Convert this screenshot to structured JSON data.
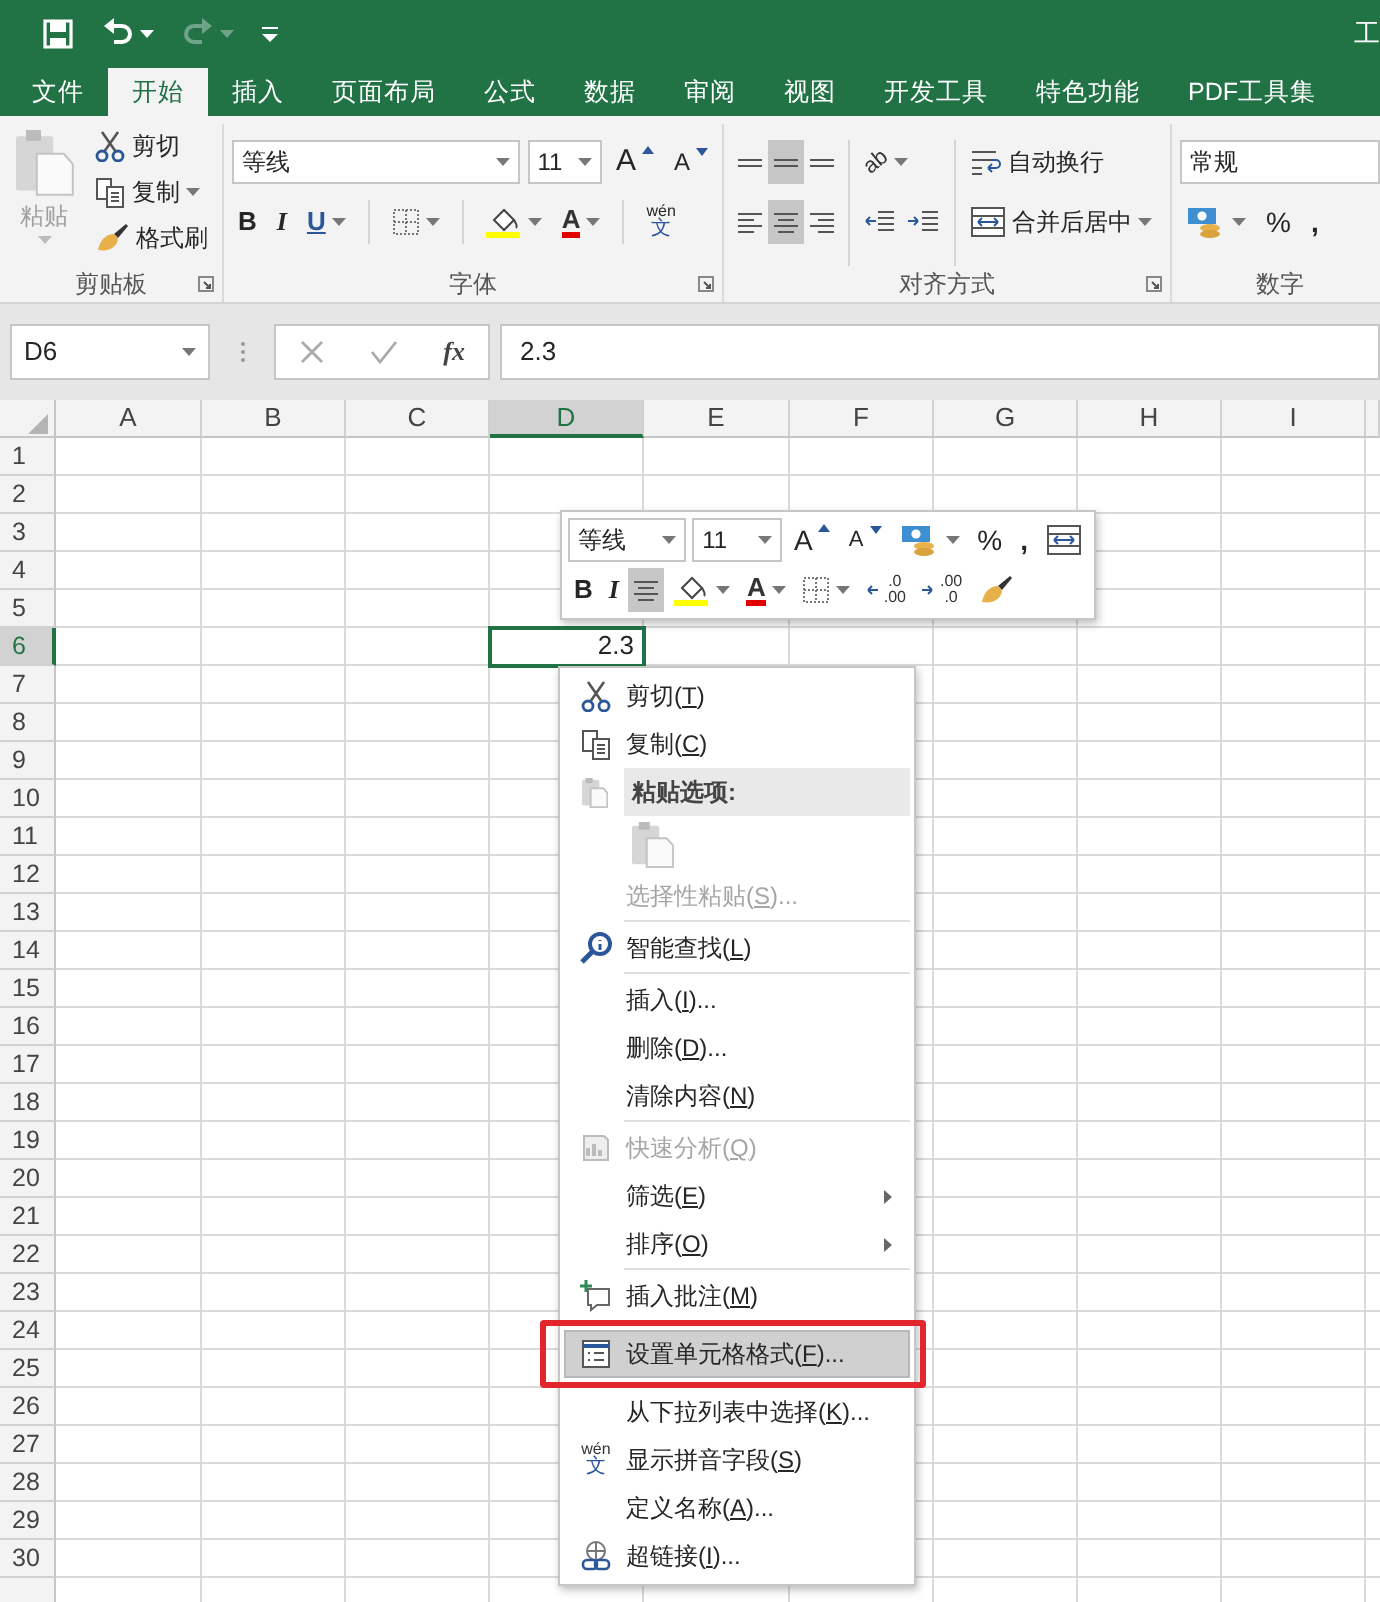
{
  "title_bar": {
    "title": "工",
    "redo": {
      "disabled": true
    }
  },
  "tabs": [
    {
      "label": "文件",
      "selected": false
    },
    {
      "label": "开始",
      "selected": true
    },
    {
      "label": "插入",
      "selected": false
    },
    {
      "label": "页面布局",
      "selected": false
    },
    {
      "label": "公式",
      "selected": false
    },
    {
      "label": "数据",
      "selected": false
    },
    {
      "label": "审阅",
      "selected": false
    },
    {
      "label": "视图",
      "selected": false
    },
    {
      "label": "开发工具",
      "selected": false
    },
    {
      "label": "特色功能",
      "selected": false
    },
    {
      "label": "PDF工具集",
      "selected": false
    }
  ],
  "clipboard_group": {
    "label": "剪贴板",
    "paste": {
      "label": "粘贴",
      "disabled": true
    },
    "cut": "剪切",
    "copy": "复制",
    "format_painter": "格式刷"
  },
  "font_group": {
    "label": "字体",
    "font_name": "等线",
    "font_size": "11",
    "grow_font": "A",
    "shrink_font": "A",
    "bold": "B",
    "italic": "I",
    "underline": "U",
    "font_color": "A",
    "phonetic_top": "wén",
    "phonetic_bottom": "文"
  },
  "alignment_group": {
    "label": "对齐方式",
    "vertical_align": [
      {
        "selected": false
      },
      {
        "selected": true
      },
      {
        "selected": false
      }
    ],
    "horizontal_align": [
      {
        "selected": false
      },
      {
        "selected": true
      },
      {
        "selected": false
      }
    ],
    "orientation": "ab",
    "wrap_text": "自动换行",
    "merge_center": "合并后居中"
  },
  "number_group": {
    "label": "数字",
    "format": "常规",
    "percent": "%",
    "comma": ","
  },
  "formula_bar": {
    "name_box": "D6",
    "insert_function": "fx",
    "value": "2.3"
  },
  "sheet": {
    "columns": [
      {
        "label": "A",
        "selected": false
      },
      {
        "label": "B",
        "selected": false
      },
      {
        "label": "C",
        "selected": false
      },
      {
        "label": "D",
        "selected": true
      },
      {
        "label": "E",
        "selected": false
      },
      {
        "label": "F",
        "selected": false
      },
      {
        "label": "G",
        "selected": false
      },
      {
        "label": "H",
        "selected": false
      },
      {
        "label": "I",
        "selected": false
      }
    ],
    "rows": [
      {
        "label": "1",
        "selected": false
      },
      {
        "label": "2",
        "selected": false
      },
      {
        "label": "3",
        "selected": false
      },
      {
        "label": "4",
        "selected": false
      },
      {
        "label": "5",
        "selected": false
      },
      {
        "label": "6",
        "selected": true
      },
      {
        "label": "7",
        "selected": false
      },
      {
        "label": "8",
        "selected": false
      },
      {
        "label": "9",
        "selected": false
      },
      {
        "label": "10",
        "selected": false
      },
      {
        "label": "11",
        "selected": false
      },
      {
        "label": "12",
        "selected": false
      },
      {
        "label": "13",
        "selected": false
      },
      {
        "label": "14",
        "selected": false
      },
      {
        "label": "15",
        "selected": false
      },
      {
        "label": "16",
        "selected": false
      },
      {
        "label": "17",
        "selected": false
      },
      {
        "label": "18",
        "selected": false
      },
      {
        "label": "19",
        "selected": false
      },
      {
        "label": "20",
        "selected": false
      },
      {
        "label": "21",
        "selected": false
      },
      {
        "label": "22",
        "selected": false
      },
      {
        "label": "23",
        "selected": false
      },
      {
        "label": "24",
        "selected": false
      },
      {
        "label": "25",
        "selected": false
      },
      {
        "label": "26",
        "selected": false
      },
      {
        "label": "27",
        "selected": false
      },
      {
        "label": "28",
        "selected": false
      },
      {
        "label": "29",
        "selected": false
      },
      {
        "label": "30",
        "selected": false
      }
    ],
    "active_cell": {
      "value": "2.3"
    }
  },
  "mini_toolbar": {
    "font_name": "等线",
    "font_size": "11",
    "grow_font": "A",
    "shrink_font": "A",
    "percent": "%",
    "comma": ",",
    "bold": "B",
    "italic": "I",
    "center_align": {
      "selected": true
    },
    "font_color": "A",
    "increase_decimal": [
      ".0",
      ".00"
    ],
    "decrease_decimal": [
      ".00",
      ".0"
    ]
  },
  "context_menu": {
    "items": [
      {
        "kind": "item",
        "label": "剪切(",
        "accel": "T",
        "suffix": ")",
        "disabled": false,
        "selected": false,
        "submenu": false
      },
      {
        "kind": "item",
        "label": "复制(",
        "accel": "C",
        "suffix": ")",
        "disabled": false,
        "selected": false,
        "submenu": false
      },
      {
        "kind": "header",
        "label": "粘贴选项:"
      },
      {
        "kind": "paste-options",
        "disabled": true
      },
      {
        "kind": "item",
        "label": "选择性粘贴(",
        "accel": "S",
        "suffix": ")...",
        "disabled": true,
        "selected": false,
        "submenu": false
      },
      {
        "kind": "separator"
      },
      {
        "kind": "item",
        "label": "智能查找(",
        "accel": "L",
        "suffix": ")",
        "disabled": false,
        "selected": false,
        "submenu": false
      },
      {
        "kind": "separator"
      },
      {
        "kind": "item",
        "label": "插入(",
        "accel": "I",
        "suffix": ")...",
        "disabled": false,
        "selected": false,
        "submenu": false
      },
      {
        "kind": "item",
        "label": "删除(",
        "accel": "D",
        "suffix": ")...",
        "disabled": false,
        "selected": false,
        "submenu": false
      },
      {
        "kind": "item",
        "label": "清除内容(",
        "accel": "N",
        "suffix": ")",
        "disabled": false,
        "selected": false,
        "submenu": false
      },
      {
        "kind": "separator"
      },
      {
        "kind": "item",
        "label": "快速分析(",
        "accel": "Q",
        "suffix": ")",
        "disabled": true,
        "selected": false,
        "submenu": false
      },
      {
        "kind": "item",
        "label": "筛选(",
        "accel": "E",
        "suffix": ")",
        "disabled": false,
        "selected": false,
        "submenu": true
      },
      {
        "kind": "item",
        "label": "排序(",
        "accel": "O",
        "suffix": ")",
        "disabled": false,
        "selected": false,
        "submenu": true
      },
      {
        "kind": "separator"
      },
      {
        "kind": "item",
        "label": "插入批注(",
        "accel": "M",
        "suffix": ")",
        "disabled": false,
        "selected": false,
        "submenu": false
      },
      {
        "kind": "item",
        "label": "设置单元格格式(",
        "accel": "F",
        "suffix": ")...",
        "disabled": false,
        "selected": true,
        "submenu": false,
        "annotated": true
      },
      {
        "kind": "item",
        "label": "从下拉列表中选择(",
        "accel": "K",
        "suffix": ")...",
        "disabled": false,
        "selected": false,
        "submenu": false
      },
      {
        "kind": "item",
        "label": "显示拼音字段(",
        "accel": "S",
        "suffix": ")",
        "disabled": false,
        "selected": false,
        "submenu": false,
        "icon_top": "wén",
        "icon_bottom": "文"
      },
      {
        "kind": "item",
        "label": "定义名称(",
        "accel": "A",
        "suffix": ")...",
        "disabled": false,
        "selected": false,
        "submenu": false
      },
      {
        "kind": "item",
        "label": "超链接(",
        "accel": "I",
        "suffix": ")...",
        "disabled": false,
        "selected": false,
        "submenu": false
      }
    ]
  }
}
